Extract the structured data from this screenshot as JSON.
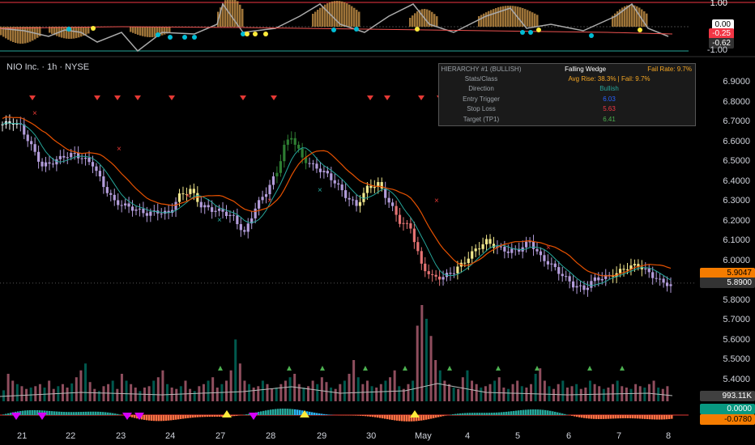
{
  "header": {
    "title": "NIO Inc. · 1h · NYSE"
  },
  "oscillator": {
    "axis": [
      {
        "label": "1.00",
        "value": 1.0
      },
      {
        "label": "0.00",
        "value": 0.0
      },
      {
        "label": "-1.00",
        "value": -1.0
      }
    ],
    "tags": [
      {
        "label": "0.00",
        "bg": "#ffffff",
        "fg": "#000000",
        "value": 0.0
      },
      {
        "label": "-0.25",
        "bg": "#f23645",
        "fg": "#ffffff",
        "value": -0.25
      },
      {
        "label": "-0.62",
        "bg": "#333333",
        "fg": "#ffffff",
        "value": -0.62
      }
    ]
  },
  "info_panel": {
    "title_key": "HIERARCHY #1 (BULLISH)",
    "title_val": "Falling Wedge",
    "fail_rate": "Fail Rate: 9.7%",
    "rows": [
      {
        "key": "Stats/Class",
        "val": "Avg Rise: 38.3% | Fail: 9.7%",
        "color": "#f5a623"
      },
      {
        "key": "Direction",
        "val": "Bullish",
        "color": "#26a69a"
      },
      {
        "key": "Entry Trigger",
        "val": "6.03",
        "color": "#2962ff"
      },
      {
        "key": "Stop Loss",
        "val": "5.63",
        "color": "#f23645"
      },
      {
        "key": "Target (TP1)",
        "val": "6.41",
        "color": "#4caf50"
      }
    ]
  },
  "price_axis": {
    "labels": [
      "6.9000",
      "6.8000",
      "6.7000",
      "6.6000",
      "6.5000",
      "6.4000",
      "6.3000",
      "6.2000",
      "6.1000",
      "6.0000",
      "5.8000",
      "5.7000",
      "5.6000",
      "5.5000",
      "5.4000"
    ],
    "last_price": {
      "label": "5.9047",
      "bg": "#f57c00"
    },
    "crosshair": {
      "label": "5.8900"
    }
  },
  "volume": {
    "tag": {
      "label": "993.11K",
      "bg": "#404040"
    }
  },
  "lower_osc": {
    "tags": [
      {
        "label": "0.0000",
        "bg": "#089981"
      },
      {
        "label": "-0.0780",
        "bg": "#f57c00"
      }
    ]
  },
  "time_axis": {
    "labels": [
      "21",
      "22",
      "23",
      "24",
      "27",
      "28",
      "29",
      "30",
      "May",
      "4",
      "5",
      "6",
      "7",
      "8"
    ]
  },
  "chart_data": {
    "type": "candlestick",
    "title": "NIO Inc. · 1h · NYSE",
    "ylim": [
      5.4,
      6.95
    ],
    "x_ticks": [
      "21",
      "22",
      "23",
      "24",
      "27",
      "28",
      "29",
      "30",
      "May",
      "4",
      "5",
      "6",
      "7",
      "8"
    ],
    "close_path": [
      [
        0,
        6.69
      ],
      [
        3,
        6.7
      ],
      [
        5,
        6.68
      ],
      [
        8,
        6.58
      ],
      [
        11,
        6.48
      ],
      [
        14,
        6.5
      ],
      [
        17,
        6.53
      ],
      [
        20,
        6.54
      ],
      [
        22,
        6.52
      ],
      [
        25,
        6.49
      ],
      [
        28,
        6.38
      ],
      [
        31,
        6.3
      ],
      [
        34,
        6.28
      ],
      [
        37,
        6.26
      ],
      [
        40,
        6.24
      ],
      [
        43,
        6.25
      ],
      [
        46,
        6.24
      ],
      [
        49,
        6.33
      ],
      [
        52,
        6.36
      ],
      [
        55,
        6.28
      ],
      [
        58,
        6.26
      ],
      [
        61,
        6.25
      ],
      [
        64,
        6.22
      ],
      [
        67,
        6.14
      ],
      [
        70,
        6.27
      ],
      [
        73,
        6.35
      ],
      [
        76,
        6.45
      ],
      [
        78,
        6.58
      ],
      [
        80,
        6.63
      ],
      [
        83,
        6.52
      ],
      [
        86,
        6.48
      ],
      [
        89,
        6.45
      ],
      [
        92,
        6.4
      ],
      [
        95,
        6.33
      ],
      [
        98,
        6.28
      ],
      [
        101,
        6.37
      ],
      [
        104,
        6.39
      ],
      [
        107,
        6.3
      ],
      [
        110,
        6.2
      ],
      [
        113,
        6.17
      ],
      [
        116,
        5.98
      ],
      [
        119,
        5.92
      ],
      [
        122,
        5.92
      ],
      [
        125,
        5.95
      ],
      [
        128,
        6.0
      ],
      [
        131,
        6.06
      ],
      [
        134,
        6.1
      ],
      [
        137,
        6.07
      ],
      [
        140,
        6.05
      ],
      [
        143,
        6.06
      ],
      [
        146,
        6.1
      ],
      [
        149,
        6.02
      ],
      [
        152,
        5.98
      ],
      [
        155,
        5.93
      ],
      [
        158,
        5.88
      ],
      [
        161,
        5.86
      ],
      [
        164,
        5.91
      ],
      [
        167,
        5.92
      ],
      [
        170,
        5.94
      ],
      [
        173,
        5.97
      ],
      [
        176,
        5.98
      ],
      [
        179,
        5.94
      ],
      [
        182,
        5.9
      ],
      [
        185,
        5.88
      ]
    ],
    "volume": [
      16,
      40,
      30,
      25,
      22,
      18,
      20,
      22,
      25,
      20,
      30,
      18,
      22,
      25,
      20,
      26,
      35,
      45,
      55,
      28,
      18,
      15,
      22,
      25,
      30,
      18,
      40,
      30,
      25,
      20,
      15,
      20,
      22,
      30,
      35,
      45,
      25,
      20,
      18,
      22,
      30,
      18,
      15,
      22,
      25,
      30,
      35,
      20,
      25,
      30,
      45,
      90,
      55,
      30,
      25,
      20,
      22,
      30,
      25,
      18,
      20,
      25,
      30,
      35,
      40,
      25,
      20,
      22,
      30,
      25,
      35,
      28,
      20,
      18,
      25,
      30,
      40,
      60,
      35,
      25,
      30,
      22,
      20,
      25,
      30,
      35,
      45,
      22,
      18,
      25,
      30,
      110,
      140,
      120,
      95,
      60,
      45,
      30,
      25,
      20,
      18,
      35,
      45,
      30,
      25,
      20,
      22,
      25,
      30,
      35,
      20,
      18,
      25,
      30,
      22,
      20,
      25,
      40,
      48,
      30,
      22,
      18,
      25,
      30,
      20,
      22,
      25,
      18,
      20,
      30,
      25,
      22,
      18,
      20,
      25,
      30,
      22,
      20,
      18,
      25,
      22,
      20,
      25,
      30,
      20,
      18,
      22
    ]
  }
}
